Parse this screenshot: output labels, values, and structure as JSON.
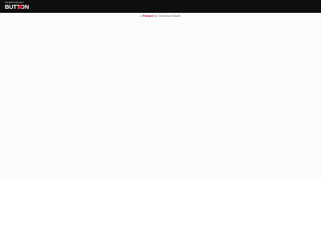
{
  "header": {
    "logo_top_text": "TEMPORARY",
    "logo_main_text": "BUTTON",
    "logo_accent_color": "#d71920",
    "background_color": "#0e0e0e"
  },
  "tagline": {
    "prefix": "A ",
    "highlight": "Podcast",
    "middle": " By ",
    "author": "Celine And Shonte"
  },
  "colors": {
    "page_background": "#fbfbfb",
    "accent": "#c8102e"
  }
}
